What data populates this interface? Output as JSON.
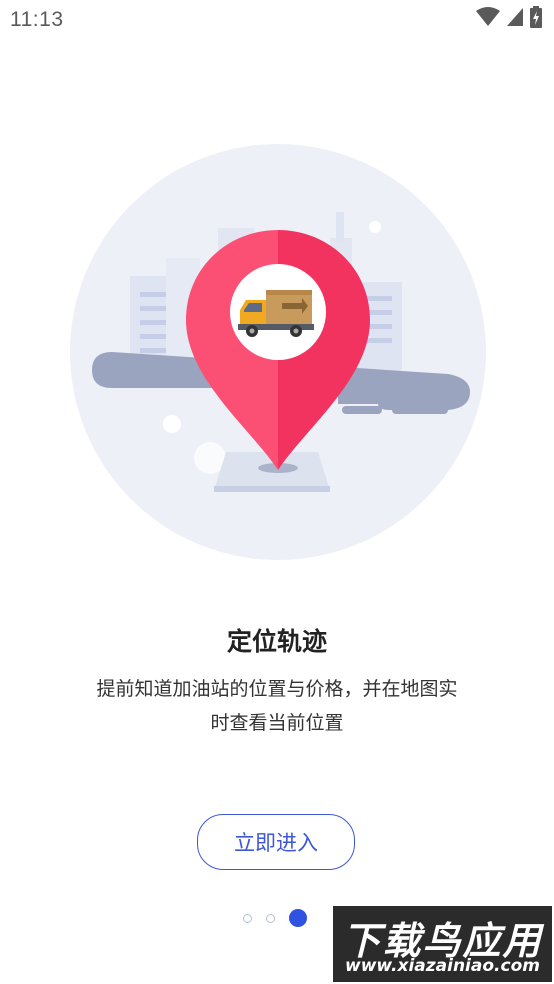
{
  "status_bar": {
    "time": "11:13",
    "icons": [
      "wifi-icon",
      "signal-icon",
      "battery-charging-icon"
    ]
  },
  "page": {
    "title": "定位轨迹",
    "description_line1": "提前知道加油站的位置与价格，并在地图实",
    "description_line2": "时查看当前位置",
    "enter_button_label": "立即进入"
  },
  "pager": {
    "count": 3,
    "active_index": 2
  },
  "watermark": {
    "main_text": "下载鸟应用",
    "url": "www.xiazainiao.com"
  },
  "colors": {
    "accent": "#3d57d6",
    "pin_left": "#fb4f74",
    "pin_right": "#f2335f",
    "circle_bg": "#eef0f8"
  }
}
